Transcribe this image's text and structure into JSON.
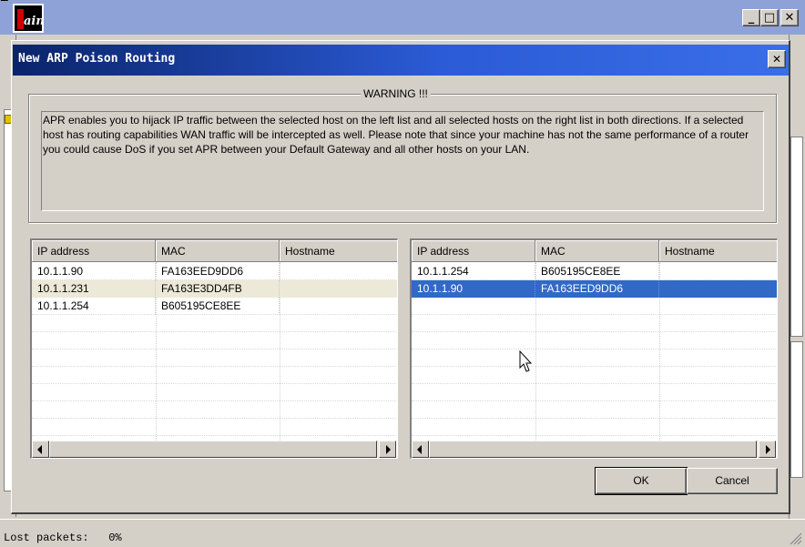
{
  "main_window": {
    "title": "",
    "icon_text": "ain",
    "min_symbol": "_",
    "max_symbol": "□",
    "close_symbol": "✕",
    "status": "Lost packets:   0%"
  },
  "dialog": {
    "title": "New ARP Poison Routing",
    "close_symbol": "✕",
    "warning": {
      "label": "WARNING !!!",
      "text": "APR enables you to hijack IP traffic between the selected host on the left list and all selected hosts on the right list in both directions. If a selected host has routing capabilities WAN traffic will be intercepted as well. Please note that since your machine has not the same performance of a router you could cause DoS if you set APR between your Default Gateway and all other hosts on your LAN."
    },
    "columns": [
      "IP address",
      "MAC",
      "Hostname"
    ],
    "left_list": {
      "rows": [
        {
          "ip": "10.1.1.90",
          "mac": "FA163EED9DD6",
          "hostname": ""
        },
        {
          "ip": "10.1.1.231",
          "mac": "FA163E3DD4FB",
          "hostname": ""
        },
        {
          "ip": "10.1.1.254",
          "mac": "B605195CE8EE",
          "hostname": ""
        }
      ]
    },
    "right_list": {
      "rows": [
        {
          "ip": "10.1.1.254",
          "mac": "B605195CE8EE",
          "hostname": ""
        },
        {
          "ip": "10.1.1.90",
          "mac": "FA163EED9DD6",
          "hostname": "",
          "selected": true
        }
      ]
    },
    "buttons": {
      "ok": "OK",
      "cancel": "Cancel"
    }
  },
  "colors": {
    "selection": "#3169c6",
    "dialog_title_start": "#0a246a",
    "dialog_title_end": "#3a6ee8",
    "window_face": "#d4d0c8"
  }
}
